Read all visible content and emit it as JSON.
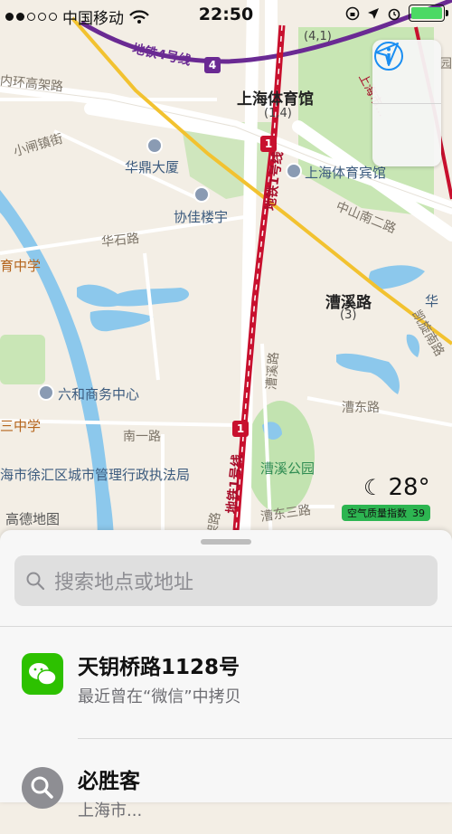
{
  "status_bar": {
    "carrier": "中国移动",
    "time": "22:50"
  },
  "map": {
    "labels": {
      "metro4": "地铁4号线",
      "metro1_top": "地铁1号线",
      "metro1_bottom": "地铁1号线",
      "neihuan": "内环高架路",
      "xiaozhajing": "小闸镇街",
      "huading": "华鼎大厦",
      "xiejia": "协佳楼宇",
      "huashi": "华石路",
      "yu_middle": "育中学",
      "stadium": "上海体育馆",
      "stadium_sub": "(1,4)",
      "top_sub": "(4,1)",
      "stadium_hotel": "上海体育宾馆",
      "zhongshan": "中山南二路",
      "caoxi_road": "漕溪路",
      "caoxi_sub": "(3)",
      "hua": "华",
      "kaixuan": "凯旋南路",
      "liuhe": "六和商务中心",
      "sanzhong": "三中学",
      "nanyi": "南一路",
      "caoxi_park": "漕溪公园",
      "caodong": "漕东路",
      "caoxi_street": "漕溪路",
      "caodong_san": "漕东三路",
      "xuhui_gov": "海市徐汇区城市管理行政执法局",
      "jialu": "架路",
      "gaode": "高德地图",
      "top_right": "上海市...",
      "yuan": "园"
    },
    "badges": {
      "line4": "4",
      "line1_a": "1",
      "line1_b": "1"
    },
    "controls": {
      "info_icon": "info-icon",
      "location_icon": "location-arrow-icon"
    },
    "weather": {
      "temperature": "28°",
      "aqi_label": "空气质量指数",
      "aqi_value": "39"
    }
  },
  "sheet": {
    "search_placeholder": "搜索地点或地址",
    "items": [
      {
        "title": "天钥桥路1128号",
        "subtitle": "最近曾在“微信”中拷贝",
        "icon": "wechat-icon",
        "icon_color": "#2dc100"
      },
      {
        "title": "必胜客",
        "subtitle": "上海市...",
        "icon": "search-icon",
        "icon_color": "#8e8e93"
      }
    ]
  },
  "colors": {
    "metro1": "#c8102e",
    "metro4": "#6a2a93",
    "yellow_road": "#f2c230",
    "water": "#7fc3ea",
    "park": "#b9dfa7",
    "accent": "#1a8ef2"
  }
}
